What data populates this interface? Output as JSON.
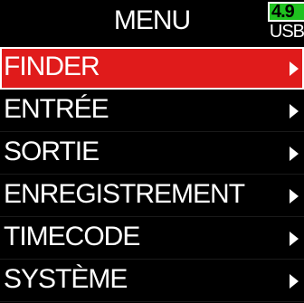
{
  "header": {
    "title": "MENU",
    "battery_level": "4.9",
    "power_source": "USB",
    "battery_color": "#1fc21f"
  },
  "menu": {
    "selected_index": 0,
    "accent_color": "#e01b1b",
    "items": [
      {
        "label": "FINDER",
        "icon": "chevron-right-icon"
      },
      {
        "label": "ENTRÉE",
        "icon": "chevron-right-icon"
      },
      {
        "label": "SORTIE",
        "icon": "chevron-right-icon"
      },
      {
        "label": "ENREGISTREMENT",
        "icon": "chevron-right-icon"
      },
      {
        "label": "TIMECODE",
        "icon": "chevron-right-icon"
      },
      {
        "label": "SYSTÈME",
        "icon": "chevron-right-icon"
      }
    ]
  }
}
